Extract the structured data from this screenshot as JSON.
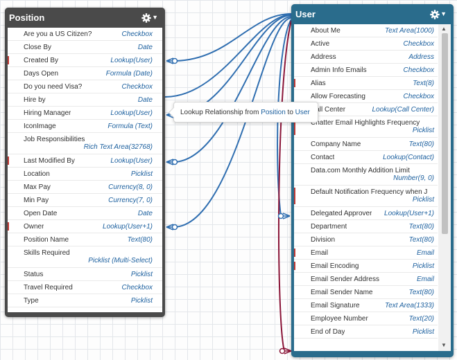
{
  "colors": {
    "position_header": "#4a4a4a",
    "user_header": "#2a6c8c",
    "lookup_line": "#2f6eb0",
    "master_detail_line": "#8a1538",
    "field_type": "#1b5f9e",
    "required_flag": "#c23934"
  },
  "position": {
    "title": "Position",
    "fields": [
      {
        "name": "Are you a US Citizen?",
        "type": "Checkbox",
        "required": false
      },
      {
        "name": "Close By",
        "type": "Date",
        "required": false
      },
      {
        "name": "Created By",
        "type": "Lookup(User)",
        "required": true
      },
      {
        "name": "Days Open",
        "type": "Formula (Date)",
        "required": false
      },
      {
        "name": "Do you need Visa?",
        "type": "Checkbox",
        "required": false
      },
      {
        "name": "Hire by",
        "type": "Date",
        "required": false
      },
      {
        "name": "Hiring Manager",
        "type": "Lookup(User)",
        "required": false
      },
      {
        "name": "IconImage",
        "type": "Formula (Text)",
        "required": false
      },
      {
        "name": "Job Responsibilities",
        "type": "Rich Text Area(32768)",
        "required": false,
        "tall": true
      },
      {
        "name": "Last Modified By",
        "type": "Lookup(User)",
        "required": true
      },
      {
        "name": "Location",
        "type": "Picklist",
        "required": false
      },
      {
        "name": "Max Pay",
        "type": "Currency(8, 0)",
        "required": false
      },
      {
        "name": "Min Pay",
        "type": "Currency(7, 0)",
        "required": false
      },
      {
        "name": "Open Date",
        "type": "Date",
        "required": false
      },
      {
        "name": "Owner",
        "type": "Lookup(User+1)",
        "required": true
      },
      {
        "name": "Position Name",
        "type": "Text(80)",
        "required": false
      },
      {
        "name": "Skills Required",
        "type": "Picklist (Multi-Select)",
        "required": false,
        "tall": true
      },
      {
        "name": "Status",
        "type": "Picklist",
        "required": false
      },
      {
        "name": "Travel Required",
        "type": "Checkbox",
        "required": false
      },
      {
        "name": "Type",
        "type": "Picklist",
        "required": false
      }
    ]
  },
  "user": {
    "title": "User",
    "fields": [
      {
        "name": "About Me",
        "type": "Text Area(1000)",
        "required": false
      },
      {
        "name": "Active",
        "type": "Checkbox",
        "required": false
      },
      {
        "name": "Address",
        "type": "Address",
        "required": false
      },
      {
        "name": "Admin Info Emails",
        "type": "Checkbox",
        "required": false
      },
      {
        "name": "Alias",
        "type": "Text(8)",
        "required": true
      },
      {
        "name": "Allow Forecasting",
        "type": "Checkbox",
        "required": false
      },
      {
        "name": "Call Center",
        "type": "Lookup(Call Center)",
        "required": false
      },
      {
        "name": "Chatter Email Highlights Frequency",
        "type": "Picklist",
        "required": true,
        "tall": true
      },
      {
        "name": "Company Name",
        "type": "Text(80)",
        "required": false
      },
      {
        "name": "Contact",
        "type": "Lookup(Contact)",
        "required": false
      },
      {
        "name": "Data.com Monthly Addition Limit",
        "type": "Number(9, 0)",
        "required": false,
        "tall": true
      },
      {
        "name": "Default Notification Frequency when J",
        "type": "Picklist",
        "required": true,
        "tall": true
      },
      {
        "name": "Delegated Approver",
        "type": "Lookup(User+1)",
        "required": false
      },
      {
        "name": "Department",
        "type": "Text(80)",
        "required": false
      },
      {
        "name": "Division",
        "type": "Text(80)",
        "required": false
      },
      {
        "name": "Email",
        "type": "Email",
        "required": true
      },
      {
        "name": "Email Encoding",
        "type": "Picklist",
        "required": true
      },
      {
        "name": "Email Sender Address",
        "type": "Email",
        "required": false
      },
      {
        "name": "Email Sender Name",
        "type": "Text(80)",
        "required": false
      },
      {
        "name": "Email Signature",
        "type": "Text Area(1333)",
        "required": false
      },
      {
        "name": "Employee Number",
        "type": "Text(20)",
        "required": false
      },
      {
        "name": "End of Day",
        "type": "Picklist",
        "required": false
      }
    ]
  },
  "tooltip": {
    "prefix": "Lookup Relationship from ",
    "from": "Position",
    "middle": " to ",
    "to": "User"
  },
  "icons": {
    "gear": "gear-icon",
    "caret": "chevron-down-icon",
    "crowfoot": "crows-foot-connector-icon"
  }
}
